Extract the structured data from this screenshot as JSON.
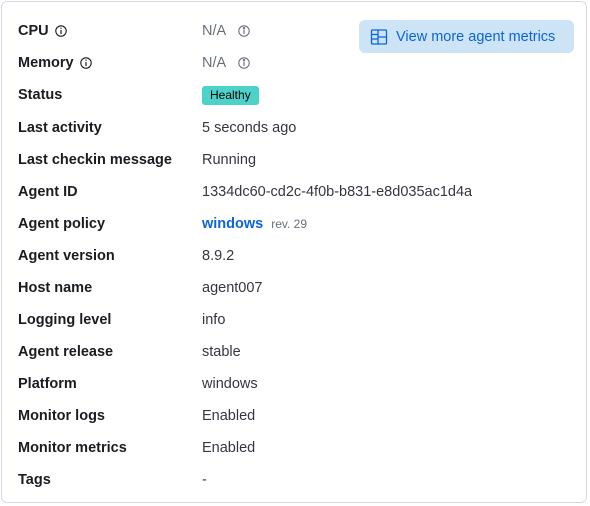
{
  "metrics_button": {
    "label": "View more agent metrics",
    "icon": "dashboard-icon"
  },
  "rows": [
    {
      "label": "CPU",
      "value": "N/A"
    },
    {
      "label": "Memory",
      "value": "N/A"
    },
    {
      "label": "Status",
      "value": "Healthy"
    },
    {
      "label": "Last activity",
      "value": "5 seconds ago"
    },
    {
      "label": "Last checkin message",
      "value": "Running"
    },
    {
      "label": "Agent ID",
      "value": "1334dc60-cd2c-4f0b-b831-e8d035ac1d4a"
    },
    {
      "label": "Agent policy",
      "value": "windows",
      "rev": "rev. 29"
    },
    {
      "label": "Agent version",
      "value": "8.9.2"
    },
    {
      "label": "Host name",
      "value": "agent007"
    },
    {
      "label": "Logging level",
      "value": "info"
    },
    {
      "label": "Agent release",
      "value": "stable"
    },
    {
      "label": "Platform",
      "value": "windows"
    },
    {
      "label": "Monitor logs",
      "value": "Enabled"
    },
    {
      "label": "Monitor metrics",
      "value": "Enabled"
    },
    {
      "label": "Tags",
      "value": "-"
    }
  ],
  "colors": {
    "status_badge_bg": "#4dd2ca",
    "link": "#0b64dd",
    "button_bg": "#cce4f5"
  }
}
